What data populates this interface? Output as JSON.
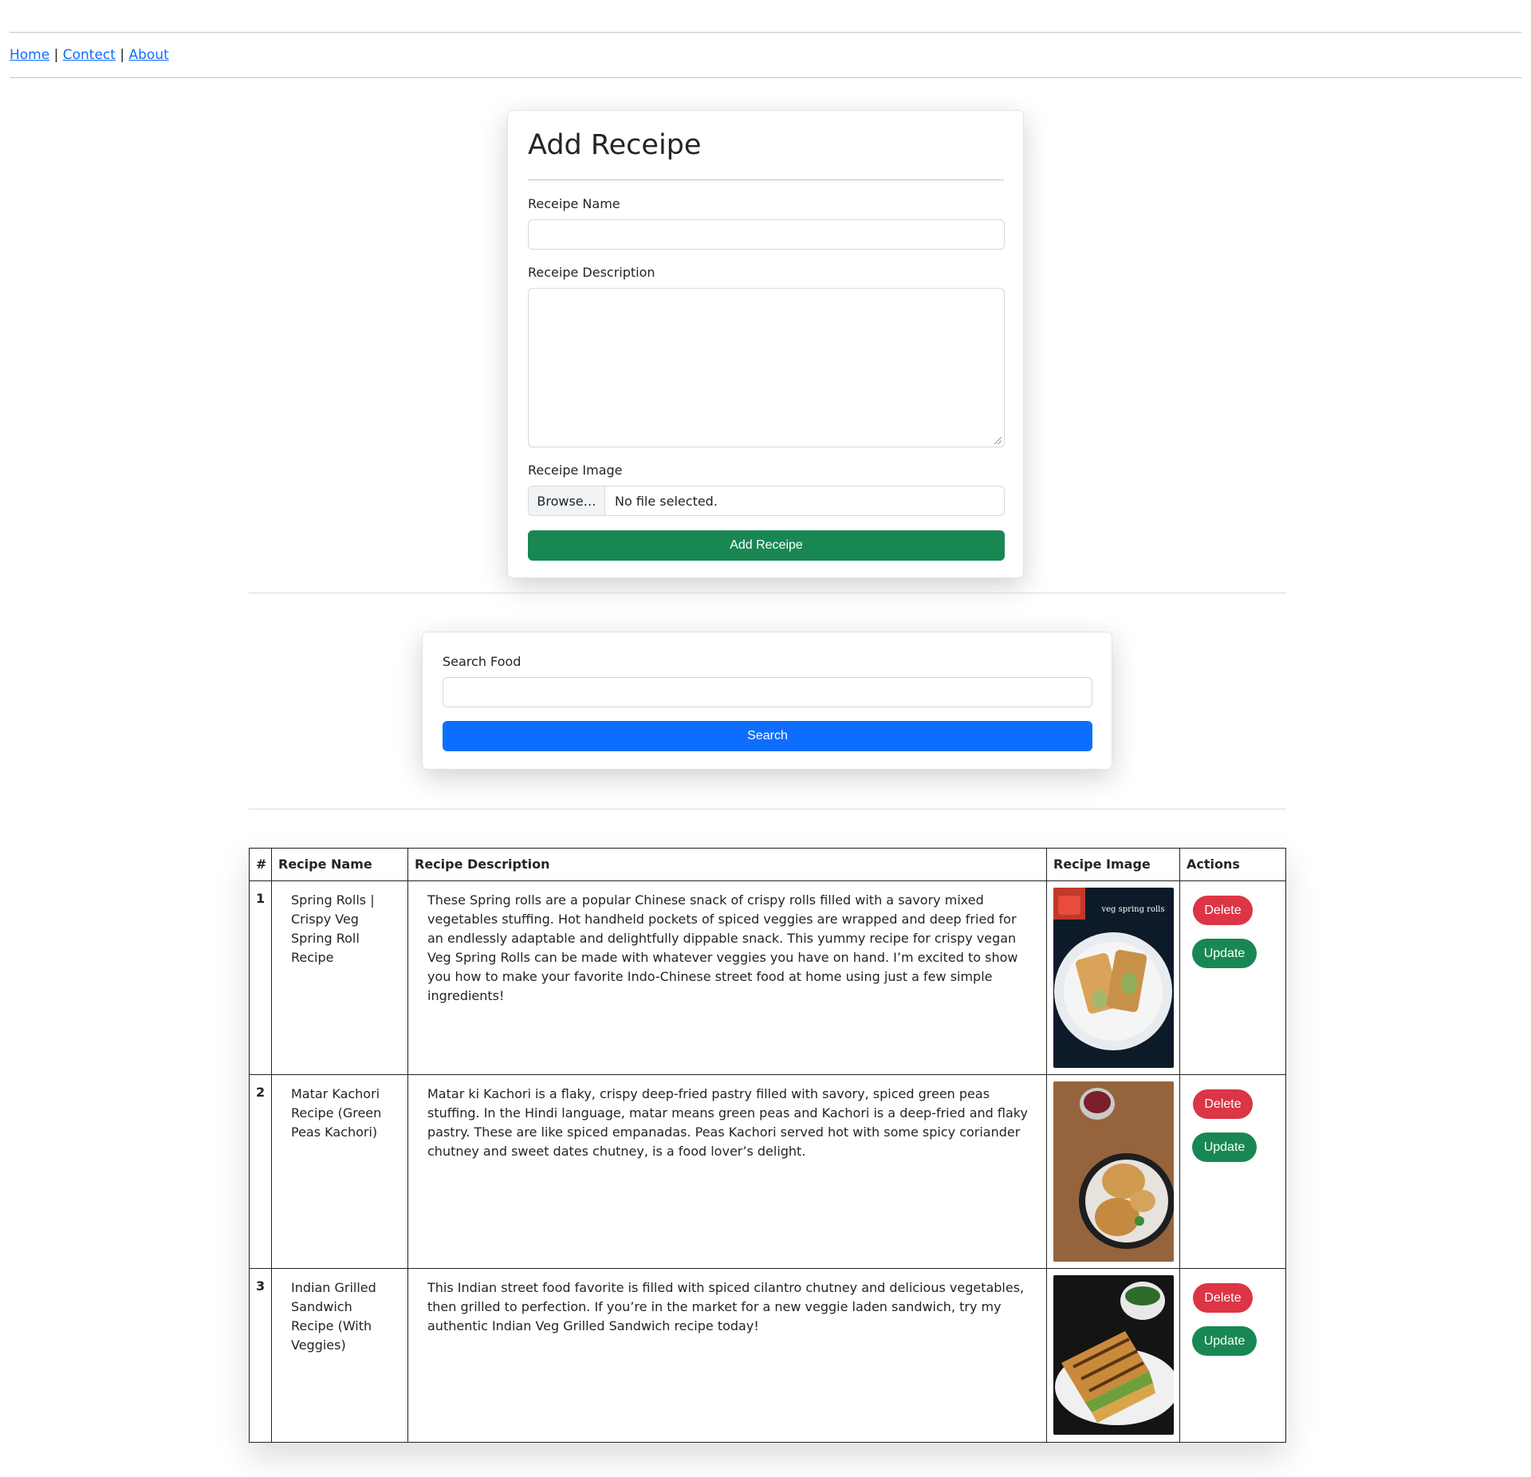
{
  "nav": {
    "home": "Home",
    "sep1": " | ",
    "contact": "Contect",
    "sep2": " | ",
    "about": "About"
  },
  "add_form": {
    "title": "Add Receipe",
    "name_label": "Receipe Name",
    "name_value": "",
    "description_label": "Receipe Description",
    "description_value": "",
    "image_label": "Receipe Image",
    "browse_label": "Browse…",
    "file_status": "No file selected.",
    "submit_label": "Add Receipe"
  },
  "search": {
    "label": "Search Food",
    "value": "",
    "button_label": "Search"
  },
  "table": {
    "headers": [
      "#",
      "Recipe Name",
      "Recipe Description",
      "Recipe Image",
      "Actions"
    ],
    "rows": [
      {
        "num": "1",
        "name": "Spring Rolls | Crispy Veg Spring Roll Recipe",
        "description": "These Spring rolls are a popular Chinese snack of crispy rolls filled with a savory mixed vegetables stuffing. Hot handheld pockets of spiced veggies are wrapped and deep fried for an endlessly adaptable and delightfully dippable snack. This yummy recipe for crispy vegan Veg Spring Rolls can be made with whatever veggies you have on hand. I’m excited to show you how to make your favorite Indo-Chinese street food at home using just a few simple ingredients!",
        "image_caption": "veg spring rolls",
        "delete_label": "Delete",
        "update_label": "Update"
      },
      {
        "num": "2",
        "name": "Matar Kachori Recipe (Green Peas Kachori)",
        "description": "Matar ki Kachori is a flaky, crispy deep-fried pastry filled with savory, spiced green peas stuffing. In the Hindi language, matar means green peas and Kachori is a deep-fried and flaky pastry. These are like spiced empanadas. Peas Kachori served hot with some spicy coriander chutney and sweet dates chutney, is a food lover’s delight.",
        "delete_label": "Delete",
        "update_label": "Update"
      },
      {
        "num": "3",
        "name": "Indian Grilled Sandwich Recipe (With Veggies)",
        "description": "This Indian street food favorite is filled with spiced cilantro chutney and delicious vegetables, then grilled to perfection. If you’re in the market for a new veggie laden sandwich, try my authentic Indian Veg Grilled Sandwich recipe today!",
        "delete_label": "Delete",
        "update_label": "Update"
      }
    ]
  },
  "colors": {
    "primary": "#0d6efd",
    "success": "#198754",
    "danger": "#dc3545",
    "link": "#0d6efd"
  }
}
